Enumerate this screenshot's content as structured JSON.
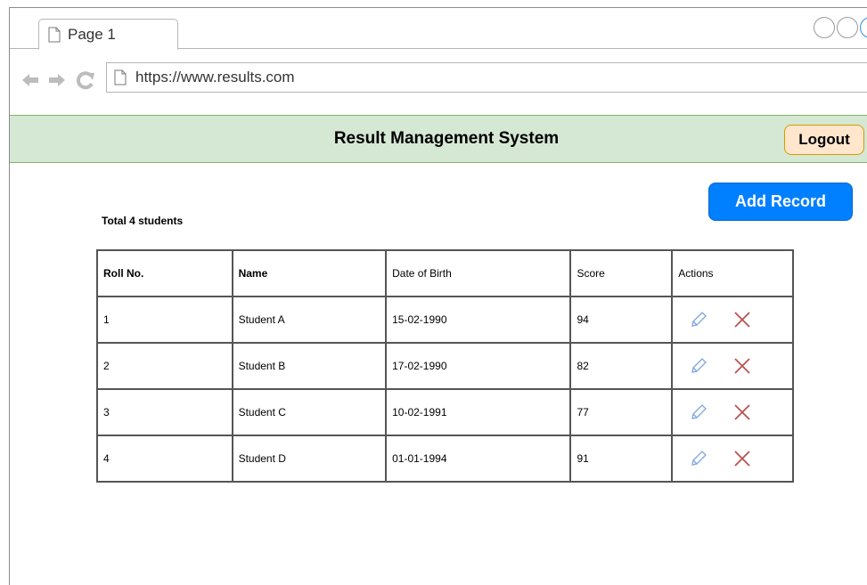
{
  "browser": {
    "tab_title": "Page 1",
    "url": "https://www.results.com"
  },
  "header": {
    "title": "Result Management System",
    "logout_label": "Logout"
  },
  "toolbar": {
    "add_label": "Add Record",
    "total_label": "Total 4 students"
  },
  "table": {
    "columns": [
      "Roll No.",
      "Name",
      "Date of Birth",
      "Score",
      "Actions"
    ],
    "rows": [
      {
        "roll": "1",
        "name": "Student A",
        "dob": "15-02-1990",
        "score": "94"
      },
      {
        "roll": "2",
        "name": "Student B",
        "dob": "17-02-1990",
        "score": "82"
      },
      {
        "roll": "3",
        "name": "Student C",
        "dob": "10-02-1991",
        "score": "77"
      },
      {
        "roll": "4",
        "name": "Student D",
        "dob": "01-01-1994",
        "score": "91"
      }
    ]
  },
  "icons": {
    "edit": "pencil-icon",
    "delete": "close-icon"
  },
  "colors": {
    "header_bg": "#d5e8d4",
    "header_border": "#82b366",
    "logout_bg": "#ffe6cc",
    "logout_border": "#d79b00",
    "primary": "#007fff",
    "edit_icon": "#7ea6e0",
    "delete_icon": "#b85450"
  }
}
